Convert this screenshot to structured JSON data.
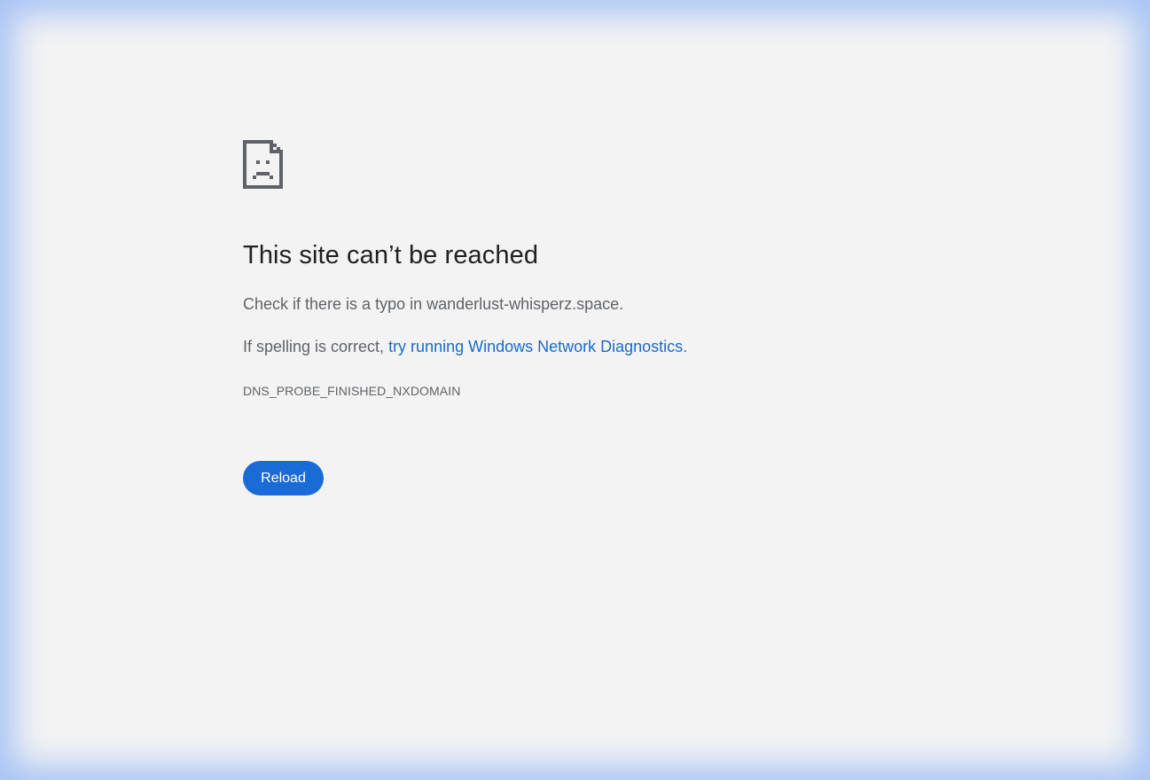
{
  "error_page": {
    "icon": "sad-document-icon",
    "headline": "This site can’t be reached",
    "line1": "Check if there is a typo in wanderlust-whisperz.space.",
    "line2_prefix": "If spelling is correct, ",
    "line2_link": "try running Windows Network Diagnostics",
    "line2_suffix": ".",
    "error_code": "DNS_PROBE_FINISHED_NXDOMAIN",
    "reload_label": "Reload"
  },
  "colors": {
    "background": "#f3f3f3",
    "headline": "#202124",
    "body_text": "#5f6368",
    "link": "#1a6bc7",
    "button": "#1a6bd8",
    "frame_glow": "#a8c4f5"
  }
}
